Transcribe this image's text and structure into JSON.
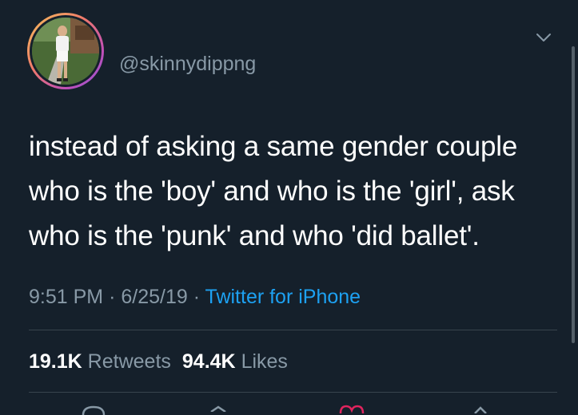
{
  "tweet": {
    "username": "@skinnydippng",
    "text_lines": [
      "instead of asking a same gender couple",
      "who is the 'boy' and who is the 'girl', ask",
      "who is the 'punk' and who 'did ballet'."
    ],
    "time": "9:51 PM",
    "date": "6/25/19",
    "separator": "·",
    "source": "Twitter for iPhone",
    "retweets_count": "19.1K",
    "retweets_label": "Retweets",
    "likes_count": "94.4K",
    "likes_label": "Likes"
  },
  "icons": {
    "menu": "chevron-down-icon",
    "actions": [
      "reply-icon",
      "retweet-icon",
      "like-icon",
      "share-icon"
    ]
  },
  "colors": {
    "background": "#15202b",
    "text": "#ffffff",
    "secondary": "#8899a6",
    "link": "#1da1f2",
    "divider": "#38444d",
    "like_accent": "#e0245e"
  }
}
